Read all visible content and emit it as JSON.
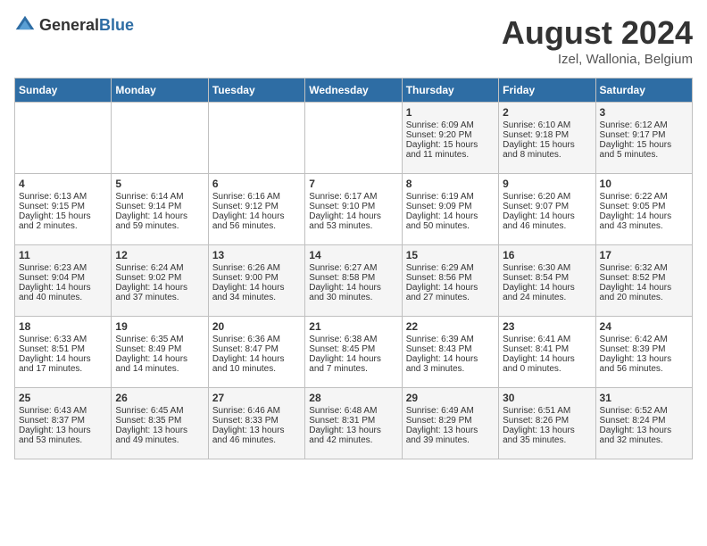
{
  "header": {
    "logo_general": "General",
    "logo_blue": "Blue",
    "month": "August 2024",
    "location": "Izel, Wallonia, Belgium"
  },
  "weekdays": [
    "Sunday",
    "Monday",
    "Tuesday",
    "Wednesday",
    "Thursday",
    "Friday",
    "Saturday"
  ],
  "weeks": [
    [
      {
        "day": "",
        "sunrise": "",
        "sunset": "",
        "daylight": ""
      },
      {
        "day": "",
        "sunrise": "",
        "sunset": "",
        "daylight": ""
      },
      {
        "day": "",
        "sunrise": "",
        "sunset": "",
        "daylight": ""
      },
      {
        "day": "",
        "sunrise": "",
        "sunset": "",
        "daylight": ""
      },
      {
        "day": "1",
        "sunrise": "Sunrise: 6:09 AM",
        "sunset": "Sunset: 9:20 PM",
        "daylight": "Daylight: 15 hours and 11 minutes."
      },
      {
        "day": "2",
        "sunrise": "Sunrise: 6:10 AM",
        "sunset": "Sunset: 9:18 PM",
        "daylight": "Daylight: 15 hours and 8 minutes."
      },
      {
        "day": "3",
        "sunrise": "Sunrise: 6:12 AM",
        "sunset": "Sunset: 9:17 PM",
        "daylight": "Daylight: 15 hours and 5 minutes."
      }
    ],
    [
      {
        "day": "4",
        "sunrise": "Sunrise: 6:13 AM",
        "sunset": "Sunset: 9:15 PM",
        "daylight": "Daylight: 15 hours and 2 minutes."
      },
      {
        "day": "5",
        "sunrise": "Sunrise: 6:14 AM",
        "sunset": "Sunset: 9:14 PM",
        "daylight": "Daylight: 14 hours and 59 minutes."
      },
      {
        "day": "6",
        "sunrise": "Sunrise: 6:16 AM",
        "sunset": "Sunset: 9:12 PM",
        "daylight": "Daylight: 14 hours and 56 minutes."
      },
      {
        "day": "7",
        "sunrise": "Sunrise: 6:17 AM",
        "sunset": "Sunset: 9:10 PM",
        "daylight": "Daylight: 14 hours and 53 minutes."
      },
      {
        "day": "8",
        "sunrise": "Sunrise: 6:19 AM",
        "sunset": "Sunset: 9:09 PM",
        "daylight": "Daylight: 14 hours and 50 minutes."
      },
      {
        "day": "9",
        "sunrise": "Sunrise: 6:20 AM",
        "sunset": "Sunset: 9:07 PM",
        "daylight": "Daylight: 14 hours and 46 minutes."
      },
      {
        "day": "10",
        "sunrise": "Sunrise: 6:22 AM",
        "sunset": "Sunset: 9:05 PM",
        "daylight": "Daylight: 14 hours and 43 minutes."
      }
    ],
    [
      {
        "day": "11",
        "sunrise": "Sunrise: 6:23 AM",
        "sunset": "Sunset: 9:04 PM",
        "daylight": "Daylight: 14 hours and 40 minutes."
      },
      {
        "day": "12",
        "sunrise": "Sunrise: 6:24 AM",
        "sunset": "Sunset: 9:02 PM",
        "daylight": "Daylight: 14 hours and 37 minutes."
      },
      {
        "day": "13",
        "sunrise": "Sunrise: 6:26 AM",
        "sunset": "Sunset: 9:00 PM",
        "daylight": "Daylight: 14 hours and 34 minutes."
      },
      {
        "day": "14",
        "sunrise": "Sunrise: 6:27 AM",
        "sunset": "Sunset: 8:58 PM",
        "daylight": "Daylight: 14 hours and 30 minutes."
      },
      {
        "day": "15",
        "sunrise": "Sunrise: 6:29 AM",
        "sunset": "Sunset: 8:56 PM",
        "daylight": "Daylight: 14 hours and 27 minutes."
      },
      {
        "day": "16",
        "sunrise": "Sunrise: 6:30 AM",
        "sunset": "Sunset: 8:54 PM",
        "daylight": "Daylight: 14 hours and 24 minutes."
      },
      {
        "day": "17",
        "sunrise": "Sunrise: 6:32 AM",
        "sunset": "Sunset: 8:52 PM",
        "daylight": "Daylight: 14 hours and 20 minutes."
      }
    ],
    [
      {
        "day": "18",
        "sunrise": "Sunrise: 6:33 AM",
        "sunset": "Sunset: 8:51 PM",
        "daylight": "Daylight: 14 hours and 17 minutes."
      },
      {
        "day": "19",
        "sunrise": "Sunrise: 6:35 AM",
        "sunset": "Sunset: 8:49 PM",
        "daylight": "Daylight: 14 hours and 14 minutes."
      },
      {
        "day": "20",
        "sunrise": "Sunrise: 6:36 AM",
        "sunset": "Sunset: 8:47 PM",
        "daylight": "Daylight: 14 hours and 10 minutes."
      },
      {
        "day": "21",
        "sunrise": "Sunrise: 6:38 AM",
        "sunset": "Sunset: 8:45 PM",
        "daylight": "Daylight: 14 hours and 7 minutes."
      },
      {
        "day": "22",
        "sunrise": "Sunrise: 6:39 AM",
        "sunset": "Sunset: 8:43 PM",
        "daylight": "Daylight: 14 hours and 3 minutes."
      },
      {
        "day": "23",
        "sunrise": "Sunrise: 6:41 AM",
        "sunset": "Sunset: 8:41 PM",
        "daylight": "Daylight: 14 hours and 0 minutes."
      },
      {
        "day": "24",
        "sunrise": "Sunrise: 6:42 AM",
        "sunset": "Sunset: 8:39 PM",
        "daylight": "Daylight: 13 hours and 56 minutes."
      }
    ],
    [
      {
        "day": "25",
        "sunrise": "Sunrise: 6:43 AM",
        "sunset": "Sunset: 8:37 PM",
        "daylight": "Daylight: 13 hours and 53 minutes."
      },
      {
        "day": "26",
        "sunrise": "Sunrise: 6:45 AM",
        "sunset": "Sunset: 8:35 PM",
        "daylight": "Daylight: 13 hours and 49 minutes."
      },
      {
        "day": "27",
        "sunrise": "Sunrise: 6:46 AM",
        "sunset": "Sunset: 8:33 PM",
        "daylight": "Daylight: 13 hours and 46 minutes."
      },
      {
        "day": "28",
        "sunrise": "Sunrise: 6:48 AM",
        "sunset": "Sunset: 8:31 PM",
        "daylight": "Daylight: 13 hours and 42 minutes."
      },
      {
        "day": "29",
        "sunrise": "Sunrise: 6:49 AM",
        "sunset": "Sunset: 8:29 PM",
        "daylight": "Daylight: 13 hours and 39 minutes."
      },
      {
        "day": "30",
        "sunrise": "Sunrise: 6:51 AM",
        "sunset": "Sunset: 8:26 PM",
        "daylight": "Daylight: 13 hours and 35 minutes."
      },
      {
        "day": "31",
        "sunrise": "Sunrise: 6:52 AM",
        "sunset": "Sunset: 8:24 PM",
        "daylight": "Daylight: 13 hours and 32 minutes."
      }
    ]
  ]
}
